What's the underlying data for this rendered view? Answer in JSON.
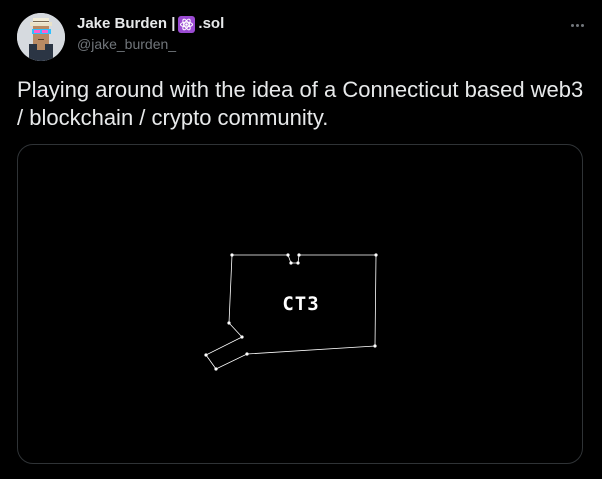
{
  "author": {
    "display_name": "Jake Burden |",
    "display_name_suffix": ".sol",
    "badge_icon": "atom-icon",
    "badge_color": "#9b4bd3",
    "handle": "@jake_burden_"
  },
  "tweet": {
    "text": "Playing around with the idea of a Connecticut based web3 / blockchain / crypto community."
  },
  "media": {
    "logo_text": "CT3",
    "background_color": "#000000",
    "outline_color": "#ffffff"
  },
  "colors": {
    "background": "#000000",
    "primary_text": "#e7e9ea",
    "secondary_text": "#71767b",
    "border": "#2f3336"
  }
}
